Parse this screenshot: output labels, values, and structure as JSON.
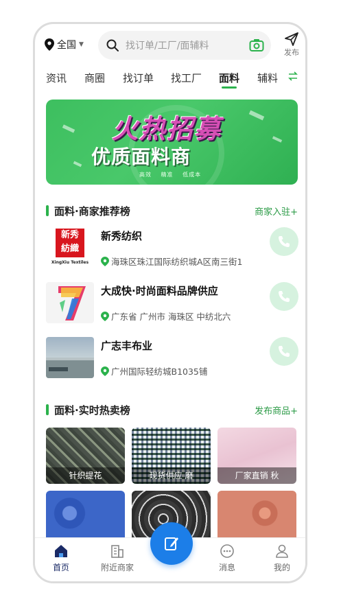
{
  "header": {
    "location": "全国",
    "search_placeholder": "找订单/工厂/面辅料",
    "publish_label": "发布"
  },
  "tabs": [
    {
      "label": "资讯"
    },
    {
      "label": "商圈"
    },
    {
      "label": "找订单"
    },
    {
      "label": "找工厂"
    },
    {
      "label": "面料",
      "active": true
    },
    {
      "label": "辅料"
    }
  ],
  "banner": {
    "title": "火热招募",
    "subtitle": "优质面料商",
    "tags": "高效 精准 低成本"
  },
  "merchant_section": {
    "title": "面料·商家推荐榜",
    "action": "商家入驻+",
    "items": [
      {
        "name": "新秀纺织",
        "address": "海珠区珠江国际纺织城A区南三街1",
        "logo_cn": "新秀\n紡織",
        "logo_en": "XingXiu Textiles"
      },
      {
        "name": "大成快·时尚面料品牌供应",
        "address": "广东省 广州市 海珠区 中纺北六"
      },
      {
        "name": "广志丰布业",
        "address": "广州国际轻纺城B1035铺"
      }
    ]
  },
  "hot_section": {
    "title": "面料·实时热卖榜",
    "action": "发布商品+",
    "items": [
      {
        "label": "针织提花"
      },
      {
        "label": "现货供应 磨"
      },
      {
        "label": "厂家直销 秋"
      },
      {
        "label": ""
      },
      {
        "label": ""
      },
      {
        "label": ""
      }
    ]
  },
  "bottom_nav": [
    {
      "label": "首页",
      "icon": "home-icon",
      "active": true
    },
    {
      "label": "附近商家",
      "icon": "building-icon"
    },
    {
      "label": "消息",
      "icon": "chat-icon"
    },
    {
      "label": "我的",
      "icon": "user-icon"
    }
  ],
  "colors": {
    "accent": "#2bb24c",
    "fab": "#1c7ee8",
    "banner_green": "#49c86a"
  }
}
